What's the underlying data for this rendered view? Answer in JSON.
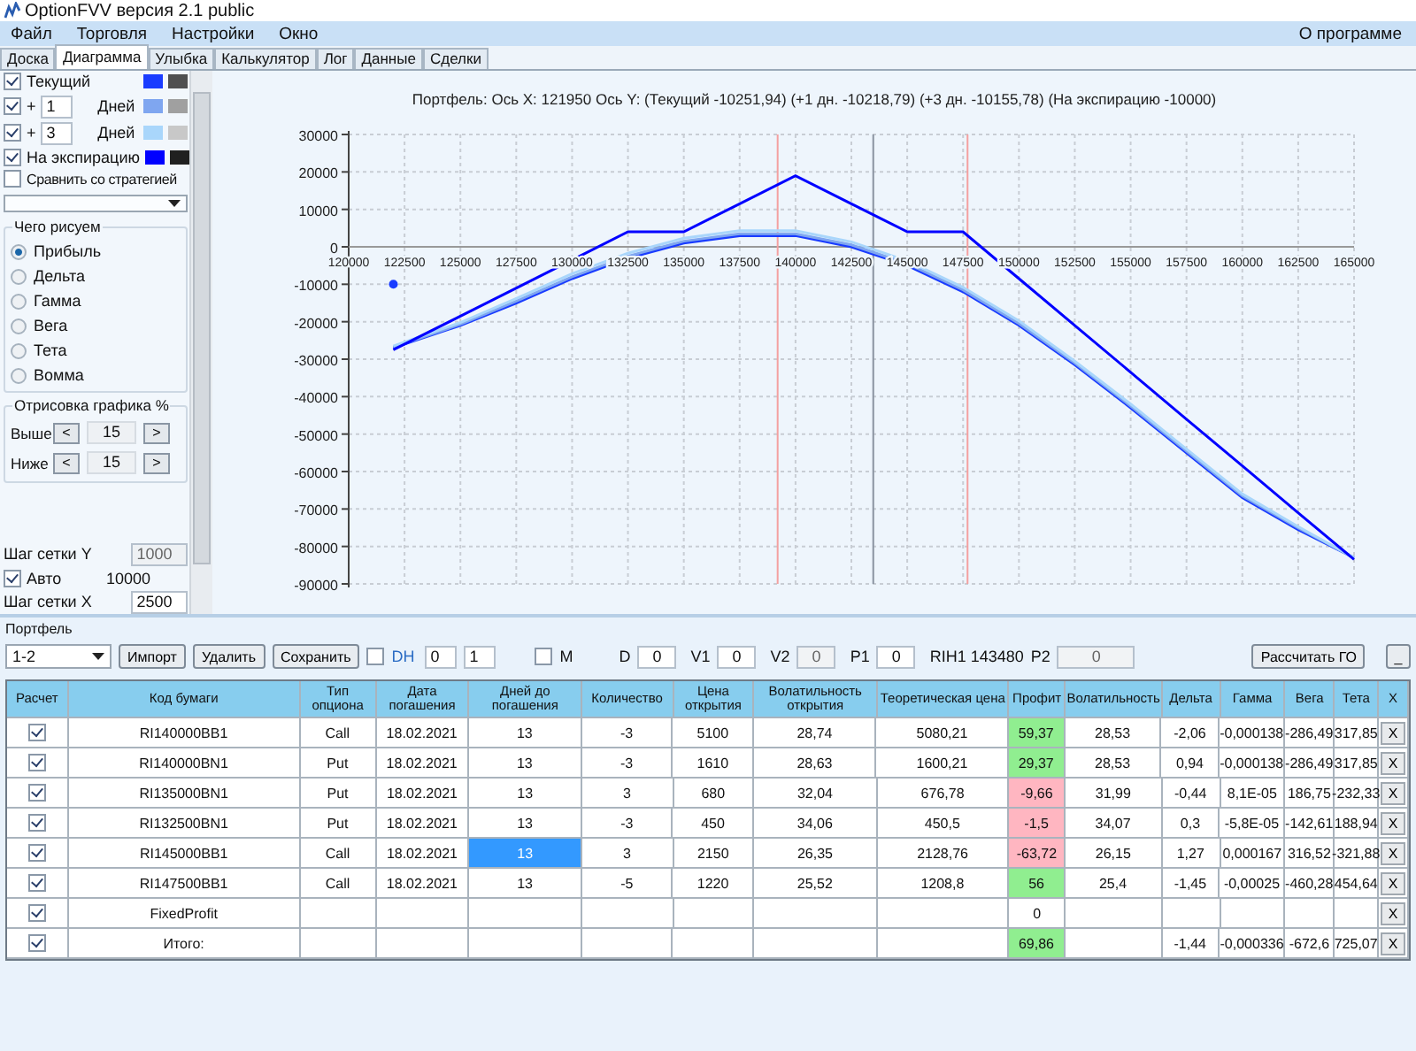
{
  "window": {
    "title": "OptionFVV версия 2.1 public"
  },
  "menu": {
    "items": [
      "Файл",
      "Торговля",
      "Настройки",
      "Окно"
    ],
    "right": "О программе"
  },
  "tabs": [
    {
      "label": "Доска",
      "selected": false
    },
    {
      "label": "Диаграмма",
      "selected": true
    },
    {
      "label": "Улыбка",
      "selected": false
    },
    {
      "label": "Калькулятор",
      "selected": false
    },
    {
      "label": "Лог",
      "selected": false
    },
    {
      "label": "Данные",
      "selected": false
    },
    {
      "label": "Сделки",
      "selected": false
    }
  ],
  "sidebar": {
    "lines": [
      {
        "kind": "check",
        "label": "Текущий",
        "checked": true,
        "swatches": [
          {
            "color": "#1a3cff"
          },
          {
            "color": "#505050"
          }
        ]
      },
      {
        "kind": "days",
        "prefix": "+",
        "value": "1",
        "unit": "Дней",
        "checked": true,
        "swatches": [
          {
            "color": "#7fa6f0"
          },
          {
            "color": "#a0a0a0"
          }
        ]
      },
      {
        "kind": "days",
        "prefix": "+",
        "value": "3",
        "unit": "Дней",
        "checked": true,
        "swatches": [
          {
            "color": "#a9d6fb"
          },
          {
            "color": "#c8c8c8"
          }
        ]
      },
      {
        "kind": "check",
        "label": "На экспирацию",
        "checked": true,
        "swatches": [
          {
            "color": "#0000ff"
          },
          {
            "color": "#202020"
          }
        ]
      }
    ],
    "compare": {
      "label": "Сравнить со стратегией",
      "checked": false
    },
    "plot_group": {
      "title": "Чего рисуем",
      "options": [
        {
          "label": "Прибыль",
          "selected": true
        },
        {
          "label": "Дельта",
          "selected": false
        },
        {
          "label": "Гамма",
          "selected": false
        },
        {
          "label": "Вега",
          "selected": false
        },
        {
          "label": "Тета",
          "selected": false
        },
        {
          "label": "Вомма",
          "selected": false
        }
      ]
    },
    "range_group": {
      "title": "Отрисовка графика %",
      "rows": [
        {
          "label": "Выше",
          "dec": "<",
          "value": "15",
          "inc": ">"
        },
        {
          "label": "Ниже",
          "dec": "<",
          "value": "15",
          "inc": ">"
        }
      ]
    },
    "grid_y": {
      "label": "Шаг сетки Y",
      "value": "1000",
      "disabled": true
    },
    "auto": {
      "label": "Авто",
      "checked": true,
      "value": "10000"
    },
    "grid_x": {
      "label": "Шаг сетки X",
      "value": "2500",
      "disabled": false
    }
  },
  "chart": {
    "chart_data": {
      "type": "line",
      "title": "Портфель: Ось X:  121950 Ось Y:  (Текущий -10251,94)  (+1 дн. -10218,79)  (+3 дн. -10155,78)  (На экспирацию -10000)",
      "x": [
        122000,
        125000,
        127500,
        130000,
        132500,
        135000,
        137500,
        140000,
        142500,
        145000,
        147500,
        150000,
        152500,
        155000,
        157500,
        160000,
        162500,
        165000
      ],
      "grid": true,
      "series": [
        {
          "color": "#1a3cff",
          "values": [
            -27000,
            -21000,
            -15000,
            -8500,
            -3000,
            1000,
            3000,
            3000,
            0,
            -5000,
            -12000,
            -21000,
            -31500,
            -43000,
            -55000,
            -67000,
            -75500,
            -83000
          ]
        },
        {
          "color": "#7fa6f0",
          "values": [
            -26800,
            -20700,
            -14500,
            -8000,
            -2500,
            1500,
            3500,
            3500,
            500,
            -4500,
            -11500,
            -20500,
            -31000,
            -42500,
            -54500,
            -66500,
            -75000,
            -83000
          ]
        },
        {
          "color": "#a9d6fb",
          "values": [
            -26500,
            -20200,
            -13800,
            -7200,
            -1700,
            2300,
            4300,
            4300,
            1300,
            -3800,
            -10800,
            -19800,
            -30500,
            -42000,
            -54000,
            -66000,
            -74700,
            -83000
          ]
        },
        {
          "color": "#0000ff",
          "values": [
            -27500,
            -18500,
            -11000,
            -3500,
            4000,
            4000,
            11500,
            19000,
            11500,
            4000,
            4000,
            -8500,
            -21000,
            -33500,
            -46000,
            -58500,
            -71000,
            -83500
          ]
        },
        {
          "color": "#1a3cff",
          "marker": true,
          "values": [
            -10000,
            null,
            null,
            null,
            null,
            null,
            null,
            null,
            null,
            null,
            null,
            null,
            null,
            null,
            null,
            null,
            null,
            null
          ]
        }
      ],
      "xlim": [
        120000,
        165000
      ],
      "ylim": [
        -90000,
        30000
      ],
      "xticks": [
        120000,
        122500,
        125000,
        127500,
        130000,
        132500,
        135000,
        137500,
        140000,
        142500,
        145000,
        147500,
        150000,
        152500,
        155000,
        157500,
        160000,
        162500,
        165000
      ],
      "yticks": [
        30000,
        20000,
        10000,
        0,
        -10000,
        -20000,
        -30000,
        -40000,
        -50000,
        -60000,
        -70000,
        -80000,
        -90000
      ],
      "ref_lines": [
        {
          "axis": "x",
          "value": 139200,
          "color": "#f4a0a0"
        },
        {
          "axis": "x",
          "value": 143480,
          "color": "#8a93a0"
        },
        {
          "axis": "x",
          "value": 147700,
          "color": "#f4a0a0"
        }
      ]
    }
  },
  "portfolio": {
    "title": "Портфель",
    "select": "1-2",
    "buttons": [
      "Импорт",
      "Удалить",
      "Сохранить"
    ],
    "dh": {
      "label": "DH",
      "checked": false
    },
    "spin_1": "0",
    "spin_2": "1",
    "m": {
      "label": "M",
      "checked": false
    },
    "fields": [
      {
        "label": "D",
        "value": "0",
        "disabled": false
      },
      {
        "label": "V1",
        "value": "0",
        "disabled": false
      },
      {
        "label": "V2",
        "value": "0",
        "disabled": true
      },
      {
        "label": "P1",
        "value": "0",
        "disabled": false
      }
    ],
    "price": "RIH1 143480",
    "p2": {
      "label": "P2",
      "value": "0",
      "disabled": true
    },
    "calc_button": "Рассчитать ГО",
    "min_button": "_"
  },
  "table": {
    "columns": [
      "Расчет",
      "Код бумаги",
      "Тип опциона",
      "Дата погашения",
      "Дней до погашения",
      "Количество",
      "Цена открытия",
      "Волатильность открытия",
      "Теоретическая цена",
      "Профит",
      "Волатильность",
      "Дельта",
      "Гамма",
      "Вега",
      "Тета",
      "X"
    ],
    "rows": [
      {
        "checked": true,
        "selected": false,
        "code": "RI140000BB1",
        "type": "Call",
        "date": "18.02.2021",
        "days": "13",
        "qty": "-3",
        "price": "5100",
        "open_vol": "28,74",
        "theo": "5080,21",
        "profit": "59,37",
        "color": "#90ee90",
        "vol": "28,53",
        "delta": "-2,06",
        "gamma": "-0,000138",
        "vega": "-286,49",
        "theta": "317,85",
        "x": "X"
      },
      {
        "checked": true,
        "selected": false,
        "code": "RI140000BN1",
        "type": "Put",
        "date": "18.02.2021",
        "days": "13",
        "qty": "-3",
        "price": "1610",
        "open_vol": "28,63",
        "theo": "1600,21",
        "profit": "29,37",
        "color": "#90ee90",
        "vol": "28,53",
        "delta": "0,94",
        "gamma": "-0,000138",
        "vega": "-286,49",
        "theta": "317,85",
        "x": "X"
      },
      {
        "checked": true,
        "selected": false,
        "code": "RI135000BN1",
        "type": "Put",
        "date": "18.02.2021",
        "days": "13",
        "qty": "3",
        "price": "680",
        "open_vol": "32,04",
        "theo": "676,78",
        "profit": "-9,66",
        "color": "#ffb6c1",
        "vol": "31,99",
        "delta": "-0,44",
        "gamma": "8,1E-05",
        "vega": "186,75",
        "theta": "-232,33",
        "x": "X"
      },
      {
        "checked": true,
        "selected": false,
        "code": "RI132500BN1",
        "type": "Put",
        "date": "18.02.2021",
        "days": "13",
        "qty": "-3",
        "price": "450",
        "open_vol": "34,06",
        "theo": "450,5",
        "profit": "-1,5",
        "color": "#ffb6c1",
        "vol": "34,07",
        "delta": "0,3",
        "gamma": "-5,8E-05",
        "vega": "-142,61",
        "theta": "188,94",
        "x": "X"
      },
      {
        "checked": true,
        "selected": true,
        "code": "RI145000BB1",
        "type": "Call",
        "date": "18.02.2021",
        "days": "13",
        "qty": "3",
        "price": "2150",
        "open_vol": "26,35",
        "theo": "2128,76",
        "profit": "-63,72",
        "color": "#ffb6c1",
        "vol": "26,15",
        "delta": "1,27",
        "gamma": "0,000167",
        "vega": "316,52",
        "theta": "-321,88",
        "x": "X"
      },
      {
        "checked": true,
        "selected": false,
        "code": "RI147500BB1",
        "type": "Call",
        "date": "18.02.2021",
        "days": "13",
        "qty": "-5",
        "price": "1220",
        "open_vol": "25,52",
        "theo": "1208,8",
        "profit": "56",
        "color": "#90ee90",
        "vol": "25,4",
        "delta": "-1,45",
        "gamma": "-0,00025",
        "vega": "-460,28",
        "theta": "454,64",
        "x": "X"
      },
      {
        "checked": true,
        "selected": false,
        "code": "FixedProfit",
        "profit": "0",
        "x": "X"
      },
      {
        "checked": true,
        "selected": false,
        "code": "Итого:",
        "profit": "69,86",
        "color": "#90ee90",
        "delta": "-1,44",
        "gamma": "-0,000336",
        "vega": "-672,6",
        "theta": "725,07",
        "x": "X"
      }
    ]
  }
}
